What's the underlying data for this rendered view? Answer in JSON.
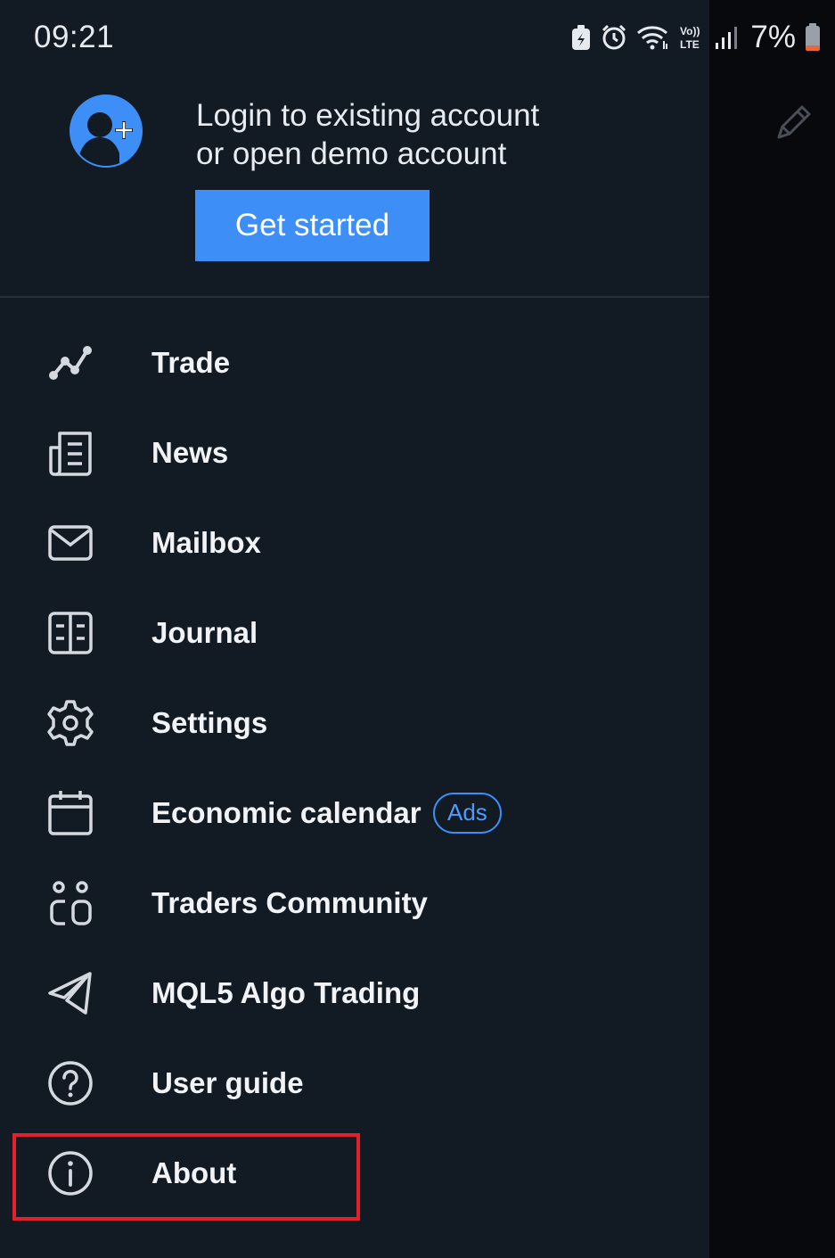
{
  "status_bar": {
    "time": "09:21",
    "battery_percent": "7%",
    "volte_label": "Vo)) LTE",
    "icons": [
      "battery-saver-icon",
      "alarm-icon",
      "wifi-icon",
      "volte-icon",
      "signal-icon",
      "battery-icon"
    ]
  },
  "account": {
    "login_text_line1": "Login to existing account",
    "login_text_line2": "or open demo account",
    "get_started_label": "Get started",
    "avatar_icon": "add-account-icon"
  },
  "menu": {
    "items": [
      {
        "label": "Trade",
        "icon": "trade-chart-icon"
      },
      {
        "label": "News",
        "icon": "news-icon"
      },
      {
        "label": "Mailbox",
        "icon": "mail-icon"
      },
      {
        "label": "Journal",
        "icon": "journal-icon"
      },
      {
        "label": "Settings",
        "icon": "gear-icon"
      },
      {
        "label": "Economic calendar",
        "icon": "calendar-icon",
        "badge": "Ads"
      },
      {
        "label": "Traders Community",
        "icon": "community-icon"
      },
      {
        "label": "MQL5 Algo Trading",
        "icon": "send-icon"
      },
      {
        "label": "User guide",
        "icon": "help-icon"
      },
      {
        "label": "About",
        "icon": "info-icon",
        "highlighted": true
      }
    ]
  },
  "background_app": {
    "icon": "edit-pencil-icon"
  },
  "colors": {
    "drawer_bg": "#121a24",
    "accent": "#3d8ef7",
    "highlight": "#e0202a",
    "text": "#f1f3f6"
  }
}
